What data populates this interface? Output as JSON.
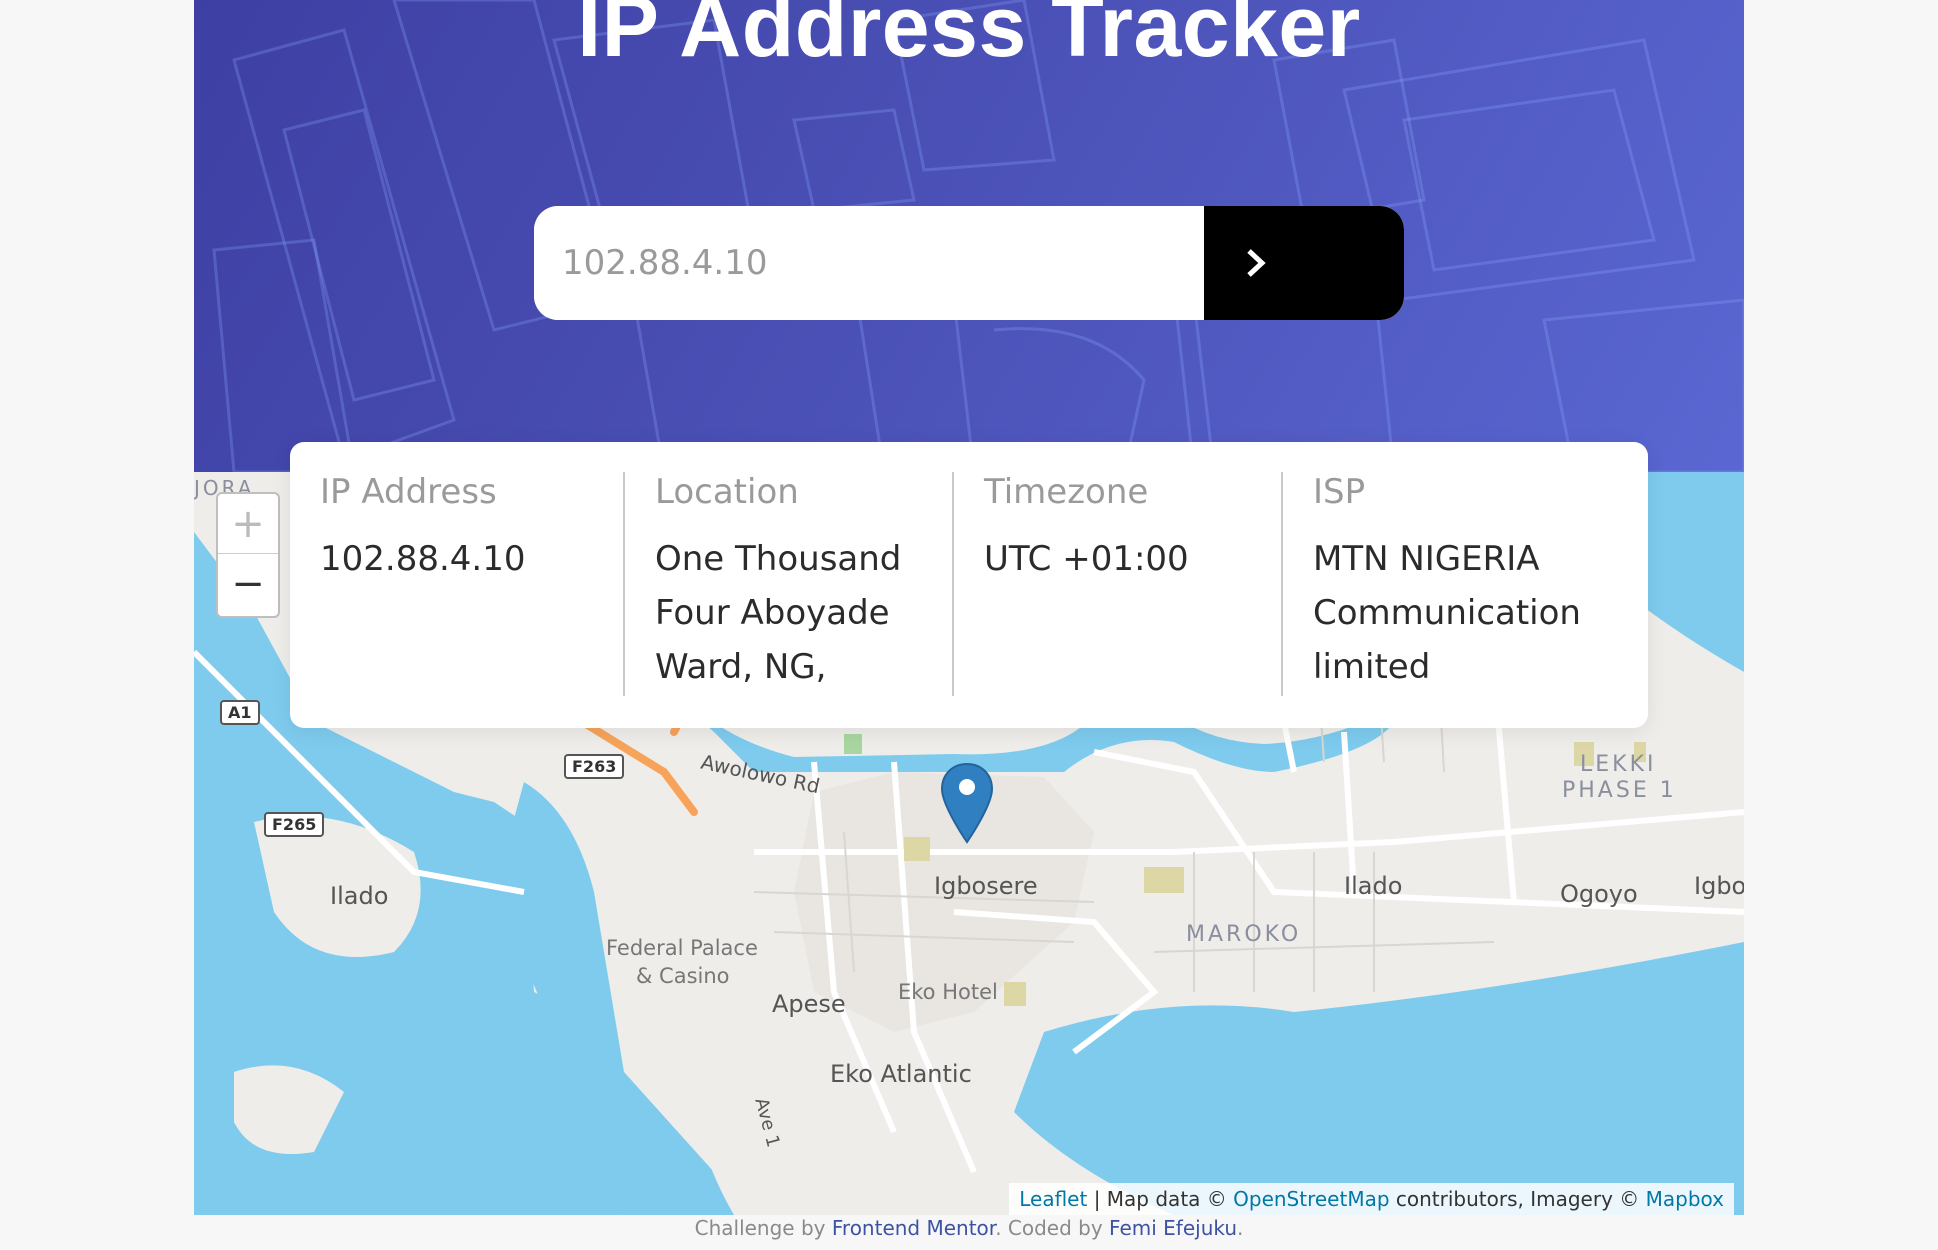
{
  "header": {
    "title": "IP Address Tracker"
  },
  "search": {
    "placeholder": "102.88.4.10",
    "submit_icon": "chevron-right-icon"
  },
  "info": {
    "ip_label": "IP Address",
    "ip_value": "102.88.4.10",
    "location_label": "Location",
    "location_value": "One Thousand Four Aboyade Ward, NG,",
    "timezone_label": "Timezone",
    "timezone_value": "UTC +01:00",
    "isp_label": "ISP",
    "isp_value": "MTN NIGERIA Communication limited"
  },
  "map": {
    "zoom_in": "+",
    "zoom_out": "−",
    "marker_icon": "map-pin-icon",
    "labels": {
      "ilado_west": "Ilado",
      "igbosere": "Igbosere",
      "ilado_east": "Ilado",
      "ogoyo": "Ogoyo",
      "igbo": "Igbo",
      "maroko": "MAROKO",
      "lekki_1": "LEKKI",
      "lekki_2": "PHASE 1",
      "federal_1": "Federal Palace",
      "federal_2": "& Casino",
      "apese": "Apese",
      "eko_hotel": "Eko Hotel",
      "eko_atlantic": "Eko Atlantic",
      "awolowo": "Awolowo Rd",
      "ave1": "Ave 1",
      "top_left_fragment": "JORA"
    },
    "road_badges": {
      "a1": "A1",
      "f263": "F263",
      "f265": "F265"
    },
    "attribution": {
      "leaflet": "Leaflet",
      "sep": " | ",
      "map_data": "Map data © ",
      "osm": "OpenStreetMap",
      "contributors": " contributors, Imagery © ",
      "mapbox": "Mapbox"
    },
    "colors": {
      "water": "#7ecbee",
      "land": "#efedea",
      "road_major": "#f7a35a",
      "marker": "#2f7fc1"
    }
  },
  "footer": {
    "challenge_by": "Challenge by ",
    "frontend_mentor": "Frontend Mentor",
    "coded_by": ". Coded by ",
    "author": "Femi Efejuku",
    "end": "."
  },
  "colors": {
    "hero_start": "#3e3fa3",
    "hero_end": "#5a67d2",
    "button": "#000000"
  }
}
